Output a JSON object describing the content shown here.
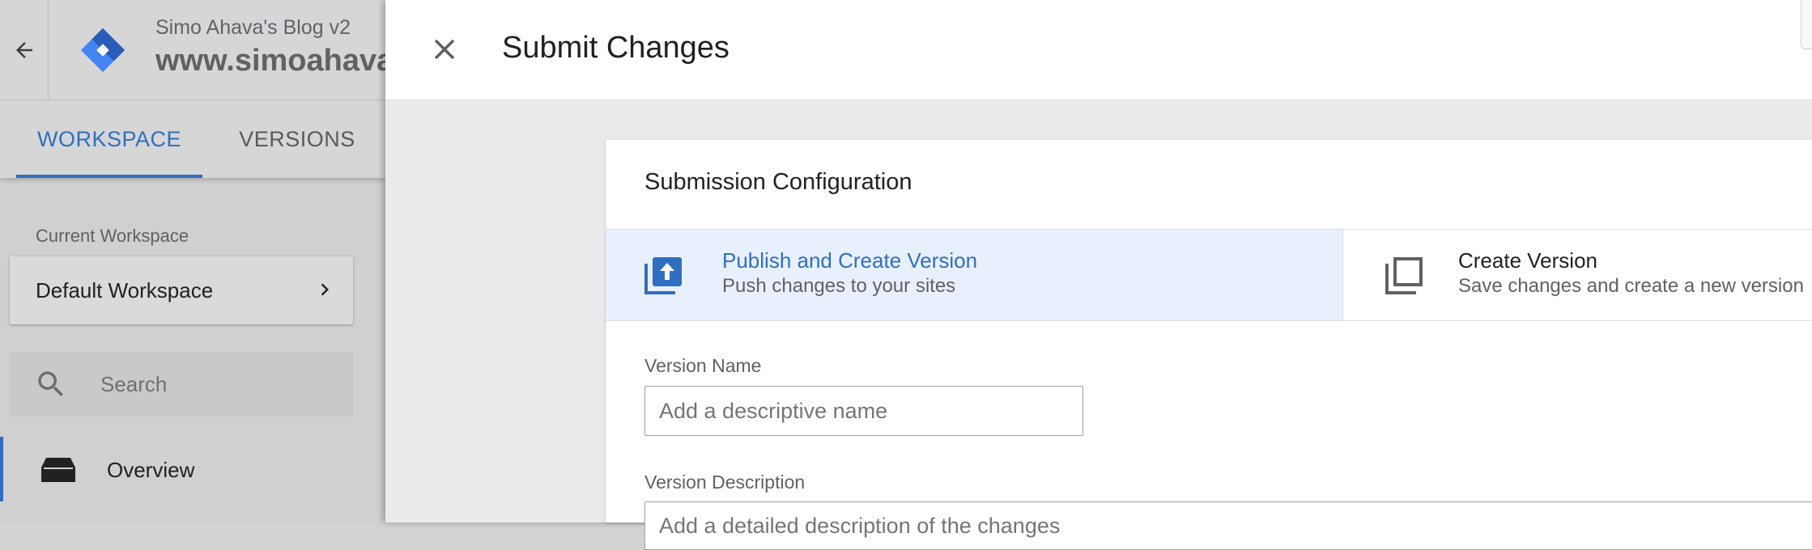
{
  "header": {
    "account_name": "Simo Ahava's Blog v2",
    "container_name": "www.simoahava.com",
    "back_icon": "arrow-back-icon",
    "logo_icon": "gtm-logo-icon"
  },
  "tabs": [
    {
      "label": "WORKSPACE",
      "active": true
    },
    {
      "label": "VERSIONS",
      "active": false
    }
  ],
  "sidebar": {
    "current_workspace_label": "Current Workspace",
    "workspace_name": "Default Workspace",
    "search_placeholder": "Search",
    "nav_items": [
      {
        "label": "Overview",
        "icon": "inbox-icon",
        "active": true
      }
    ]
  },
  "panel": {
    "title": "Submit Changes",
    "close_icon": "close-icon",
    "card": {
      "title": "Submission Configuration",
      "options": [
        {
          "title": "Publish and Create Version",
          "subtitle": "Push changes to your sites",
          "icon": "publish-icon",
          "selected": true
        },
        {
          "title": "Create Version",
          "subtitle": "Save changes and create a new version",
          "icon": "copy-version-icon",
          "selected": false
        }
      ],
      "version_name": {
        "label": "Version Name",
        "placeholder": "Add a descriptive name",
        "value": ""
      },
      "version_description": {
        "label": "Version Description",
        "placeholder": "Add a detailed description of the changes",
        "value": ""
      }
    }
  },
  "colors": {
    "accent": "#2f6fc0",
    "selected_option_bg": "#e8f0fe",
    "panel_bg": "#ebebeb",
    "logo_blue": "#4285f4",
    "logo_dark": "#2a5dba"
  }
}
